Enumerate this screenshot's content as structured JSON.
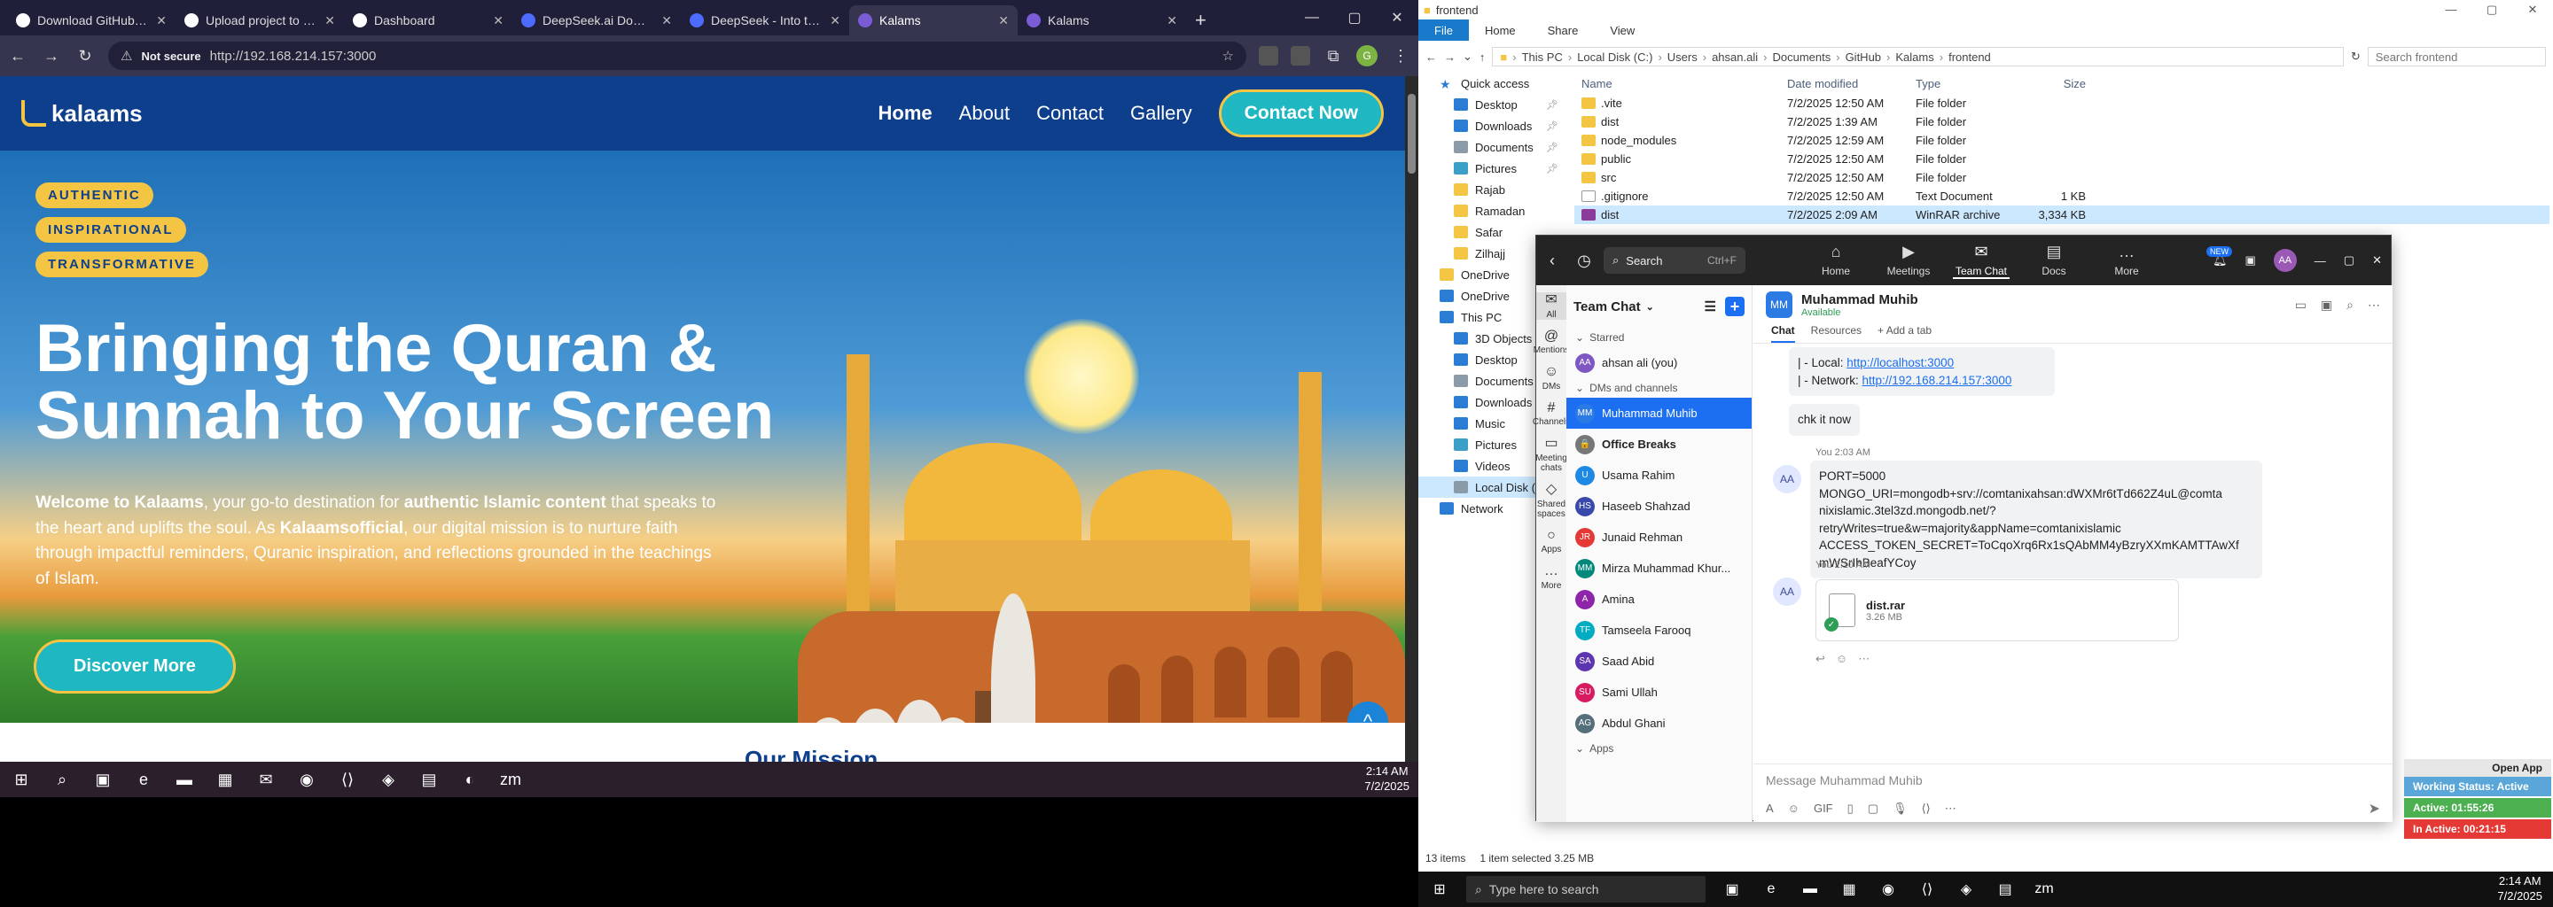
{
  "browser": {
    "tabs": [
      {
        "title": "Download GitHub Des"
      },
      {
        "title": "Upload project to kala"
      },
      {
        "title": "Dashboard"
      },
      {
        "title": "DeepSeek.ai Domain F"
      },
      {
        "title": "DeepSeek - Into the U"
      },
      {
        "title": "Kalams"
      },
      {
        "title": "Kalams"
      }
    ],
    "not_secure": "Not secure",
    "url": "http://192.168.214.157:3000",
    "profile_initial": "G"
  },
  "site": {
    "logo": "kalaams",
    "nav": [
      "Home",
      "About",
      "Contact",
      "Gallery"
    ],
    "cta": "Contact Now",
    "badges": [
      "AUTHENTIC",
      "INSPIRATIONAL",
      "TRANSFORMATIVE"
    ],
    "title": "Bringing the Quran & Sunnah to Your Screen",
    "text_1": "Welcome to Kalaams",
    "text_2": ", your go-to destination for ",
    "text_3": "authentic Islamic content",
    "text_4": " that speaks to the heart and uplifts the soul. As ",
    "text_5": "Kalaamsofficial",
    "text_6": ", our digital mission is to nurture faith through impactful reminders, Quranic inspiration, and reflections grounded in the teachings of Islam.",
    "discover": "Discover More",
    "next_section": "Our Mission"
  },
  "taskbar_left": {
    "time": "2:14 AM",
    "date": "7/2/2025"
  },
  "explorer": {
    "title": "frontend",
    "ribbon": [
      "File",
      "Home",
      "Share",
      "View"
    ],
    "crumbs": [
      "This PC",
      "Local Disk (C:)",
      "Users",
      "ahsan.ali",
      "Documents",
      "GitHub",
      "Kalams",
      "frontend"
    ],
    "search": "Search frontend",
    "nav": [
      {
        "label": "Quick access",
        "icon": "star",
        "level": 1
      },
      {
        "label": "Desktop",
        "icon": "blue",
        "level": 2,
        "pin": true
      },
      {
        "label": "Downloads",
        "icon": "blue",
        "level": 2,
        "pin": true
      },
      {
        "label": "Documents",
        "icon": "gray",
        "level": 2,
        "pin": true
      },
      {
        "label": "Pictures",
        "icon": "teal",
        "level": 2,
        "pin": true
      },
      {
        "label": "Rajab",
        "icon": "yellow",
        "level": 2
      },
      {
        "label": "Ramadan",
        "icon": "yellow",
        "level": 2
      },
      {
        "label": "Safar",
        "icon": "yellow",
        "level": 2
      },
      {
        "label": "Zilhajj",
        "icon": "yellow",
        "level": 2
      },
      {
        "label": "OneDrive",
        "icon": "yellow",
        "level": 1
      },
      {
        "label": "OneDrive",
        "icon": "blue",
        "level": 1
      },
      {
        "label": "This PC",
        "icon": "blue",
        "level": 1
      },
      {
        "label": "3D Objects",
        "icon": "blue",
        "level": 2
      },
      {
        "label": "Desktop",
        "icon": "blue",
        "level": 2
      },
      {
        "label": "Documents",
        "icon": "gray",
        "level": 2
      },
      {
        "label": "Downloads",
        "icon": "blue",
        "level": 2
      },
      {
        "label": "Music",
        "icon": "blue",
        "level": 2
      },
      {
        "label": "Pictures",
        "icon": "teal",
        "level": 2
      },
      {
        "label": "Videos",
        "icon": "blue",
        "level": 2
      },
      {
        "label": "Local Disk (C:)",
        "icon": "gray",
        "level": 2,
        "selected": true
      },
      {
        "label": "Network",
        "icon": "blue",
        "level": 1
      }
    ],
    "columns": [
      "Name",
      "Date modified",
      "Type",
      "Size"
    ],
    "files": [
      {
        "name": ".vite",
        "date": "7/2/2025 12:50 AM",
        "type": "File folder",
        "size": "",
        "kind": "folder"
      },
      {
        "name": "dist",
        "date": "7/2/2025 1:39 AM",
        "type": "File folder",
        "size": "",
        "kind": "folder"
      },
      {
        "name": "node_modules",
        "date": "7/2/2025 12:59 AM",
        "type": "File folder",
        "size": "",
        "kind": "folder"
      },
      {
        "name": "public",
        "date": "7/2/2025 12:50 AM",
        "type": "File folder",
        "size": "",
        "kind": "folder"
      },
      {
        "name": "src",
        "date": "7/2/2025 12:50 AM",
        "type": "File folder",
        "size": "",
        "kind": "folder"
      },
      {
        "name": ".gitignore",
        "date": "7/2/2025 12:50 AM",
        "type": "Text Document",
        "size": "1 KB",
        "kind": "doc"
      },
      {
        "name": "dist",
        "date": "7/2/2025 2:09 AM",
        "type": "WinRAR archive",
        "size": "3,334 KB",
        "kind": "rar",
        "selected": true
      }
    ],
    "status_items": "13 items",
    "status_selected": "1 item selected  3.25 MB"
  },
  "zoom": {
    "search": "Search",
    "search_kb": "Ctrl+F",
    "nav": [
      {
        "label": "Home",
        "icon": "⌂"
      },
      {
        "label": "Meetings",
        "icon": "▶"
      },
      {
        "label": "Team Chat",
        "icon": "✉",
        "active": true
      },
      {
        "label": "Docs",
        "icon": "▤"
      },
      {
        "label": "More",
        "icon": "…"
      }
    ],
    "new_badge": "NEW",
    "avatar": "AA",
    "rail": [
      {
        "label": "All",
        "icon": "✉",
        "active": true
      },
      {
        "label": "Mentions",
        "icon": "@"
      },
      {
        "label": "DMs",
        "icon": "☺"
      },
      {
        "label": "Channels",
        "icon": "#"
      },
      {
        "label": "Meeting chats",
        "icon": "▭"
      },
      {
        "label": "Shared spaces",
        "icon": "◇"
      },
      {
        "label": "Apps",
        "icon": "○"
      },
      {
        "label": "More",
        "icon": "…"
      }
    ],
    "side_title": "Team Chat",
    "starred": "Starred",
    "dms_channels": "DMs and channels",
    "apps": "Apps",
    "starred_items": [
      {
        "name": "ahsan ali (you)",
        "initials": "AA",
        "color": "#7e57c2"
      }
    ],
    "chats": [
      {
        "name": "Muhammad Muhib",
        "initials": "MM",
        "color": "#2c7be5",
        "active": true
      },
      {
        "name": "Office Breaks",
        "initials": "🔒",
        "color": "#777",
        "bold": true
      },
      {
        "name": "Usama Rahim",
        "initials": "U",
        "color": "#1e88e5"
      },
      {
        "name": "Haseeb Shahzad",
        "initials": "HS",
        "color": "#3949ab"
      },
      {
        "name": "Junaid Rehman",
        "initials": "JR",
        "color": "#e53935"
      },
      {
        "name": "Mirza Muhammad Khur...",
        "initials": "MM",
        "color": "#00897b"
      },
      {
        "name": "Amina",
        "initials": "A",
        "color": "#8e24aa"
      },
      {
        "name": "Tamseela Farooq",
        "initials": "TF",
        "color": "#00acc1"
      },
      {
        "name": "Saad Abid",
        "initials": "SA",
        "color": "#5e35b1"
      },
      {
        "name": "Sami Ullah",
        "initials": "SU",
        "color": "#d81b60"
      },
      {
        "name": "Abdul Ghani",
        "initials": "AG",
        "color": "#546e7a"
      }
    ],
    "chat_name": "Muhammad Muhib",
    "chat_status": "Available",
    "tabs": [
      "Chat",
      "Resources",
      "+ Add a tab"
    ],
    "msg_local_label": "|   - Local:",
    "msg_local_link": "http://localhost:3000",
    "msg_net_label": "|   - Network:",
    "msg_net_link": "http://192.168.214.157:3000",
    "msg_chk": "chk it now",
    "time_1": "You 2:03 AM",
    "env_lines": [
      "PORT=5000",
      "MONGO_URI=mongodb+srv://comtanixahsan:dWXMr6tTd662Z4uL@comta",
      "nixislamic.3tel3zd.mongodb.net/?",
      "retryWrites=true&w=majority&appName=comtanixislamic",
      "ACCESS_TOKEN_SECRET=ToCqoXrq6Rx1sQAbMM4yBzryXXmKAMTTAwXf",
      "mWSrIhBeafYCoy"
    ],
    "time_2": "You 2:10 AM",
    "file_name": "dist.rar",
    "file_size": "3.26 MB",
    "compose_placeholder": "Message Muhammad Muhib",
    "msg_avatar": "AA"
  },
  "status_widget": {
    "open_app": "Open App",
    "working": "Working Status: Active",
    "active": "Active: 01:55:26",
    "inactive": "In Active: 00:21:15"
  },
  "taskbar_right": {
    "search": "Type here to search",
    "time": "2:14 AM",
    "date": "7/2/2025"
  }
}
